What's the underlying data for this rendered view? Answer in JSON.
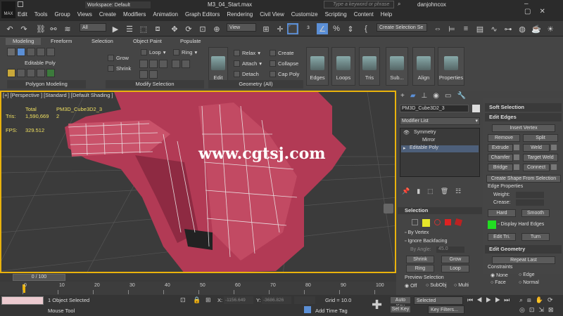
{
  "app": {
    "logo": "MAX",
    "workspace": "Workspace: Default",
    "file_name": "M3_04_Start.max",
    "search_placeholder": "Type a keyword or phrase",
    "user": "danjohncox"
  },
  "menu": [
    "Edit",
    "Tools",
    "Group",
    "Views",
    "Create",
    "Modifiers",
    "Animation",
    "Graph Editors",
    "Rendering",
    "Civil View",
    "Customize",
    "Scripting",
    "Content",
    "Help"
  ],
  "toolbar": {
    "filter": "All",
    "ref_coord": "View",
    "selection_set": "Create Selection Se"
  },
  "ribbon": {
    "tabs": [
      "Modeling",
      "Freeform",
      "Selection",
      "Object Paint",
      "Populate"
    ],
    "active_tab": "Modeling",
    "editable_poly": "Editable Poly",
    "poly_modeling": "Polygon Modeling",
    "modify_selection": "Modify Selection",
    "geometry_all": "Geometry (All)",
    "grow": "Grow",
    "shrink": "Shrink",
    "loop": "Loop",
    "ring": "Ring",
    "edit": "Edit",
    "relax": "Relax",
    "attach": "Attach",
    "detach": "Detach",
    "create": "Create",
    "collapse": "Collapse",
    "cap_poly": "Cap Poly",
    "edges": "Edges",
    "loops": "Loops",
    "tris": "Tris",
    "sub": "Sub...",
    "align": "Align",
    "properties": "Properties"
  },
  "viewport": {
    "label": "[+] [Perspective ] [Standard ] [Default Shading ]",
    "total_label": "Total",
    "object_name": "PM3D_Cube3D2_3",
    "tris_label": "Tris:",
    "tris_total": "1,590,669",
    "tris_obj": "2",
    "fps_label": "FPS:",
    "fps": "329.512",
    "watermark": "www.cgtsj.com"
  },
  "command_panel": {
    "object_name": "PM3D_Cube3D2_3",
    "modifier_list": "Modifier List",
    "stack": [
      "Symmetry",
      "Mirror",
      "Editable Poly"
    ],
    "selection_title": "Selection",
    "by_vertex": "By Vertex",
    "ignore_backfacing": "Ignore Backfacing",
    "by_angle": "By Angle:",
    "by_angle_val": "45.0",
    "shrink": "Shrink",
    "grow": "Grow",
    "ring": "Ring",
    "loop": "Loop",
    "preview_selection": "Preview Selection",
    "off": "Off",
    "subobj": "SubObj",
    "multi": "Multi"
  },
  "right_panel": {
    "soft_selection": "Soft Selection",
    "edit_edges": "Edit Edges",
    "insert_vertex": "Insert Vertex",
    "remove": "Remove",
    "split": "Split",
    "extrude": "Extrude",
    "weld": "Weld",
    "chamfer": "Chamfer",
    "target_weld": "Target Weld",
    "bridge": "Bridge",
    "connect": "Connect",
    "create_shape": "Create Shape From Selection",
    "edge_properties": "Edge Properties",
    "weight": "Weight:",
    "crease": "Crease:",
    "hard": "Hard",
    "smooth": "Smooth",
    "display_hard_edges": "Display Hard Edges",
    "edit_tri": "Edit Tri.",
    "turn": "Turn",
    "edit_geometry": "Edit Geometry",
    "repeat_last": "Repeat Last",
    "constraints": "Constraints",
    "none": "None",
    "edge": "Edge",
    "face": "Face",
    "normal": "Normal",
    "hard_edge_color": "#22dd22"
  },
  "timeline": {
    "frame": "0 / 100",
    "ticks": [
      "0",
      "10",
      "20",
      "30",
      "40",
      "50",
      "60",
      "70",
      "80",
      "90",
      "100"
    ]
  },
  "status": {
    "selected": "1 Object Selected",
    "tool": "Mouse Tool",
    "x_label": "X:",
    "x_val": "-1156.649",
    "y_label": "Y:",
    "y_val": "-3686.826",
    "grid": "Grid = 10.0",
    "add_time_tag": "Add Time Tag",
    "auto_key": "Auto Key",
    "set_key": "Set Key",
    "selected_dd": "Selected",
    "key_filters": "Key Filters..."
  },
  "colors": {
    "viewport_border": "#e9b20c",
    "mesh": "#b23a55",
    "stats": "#f0e060"
  }
}
